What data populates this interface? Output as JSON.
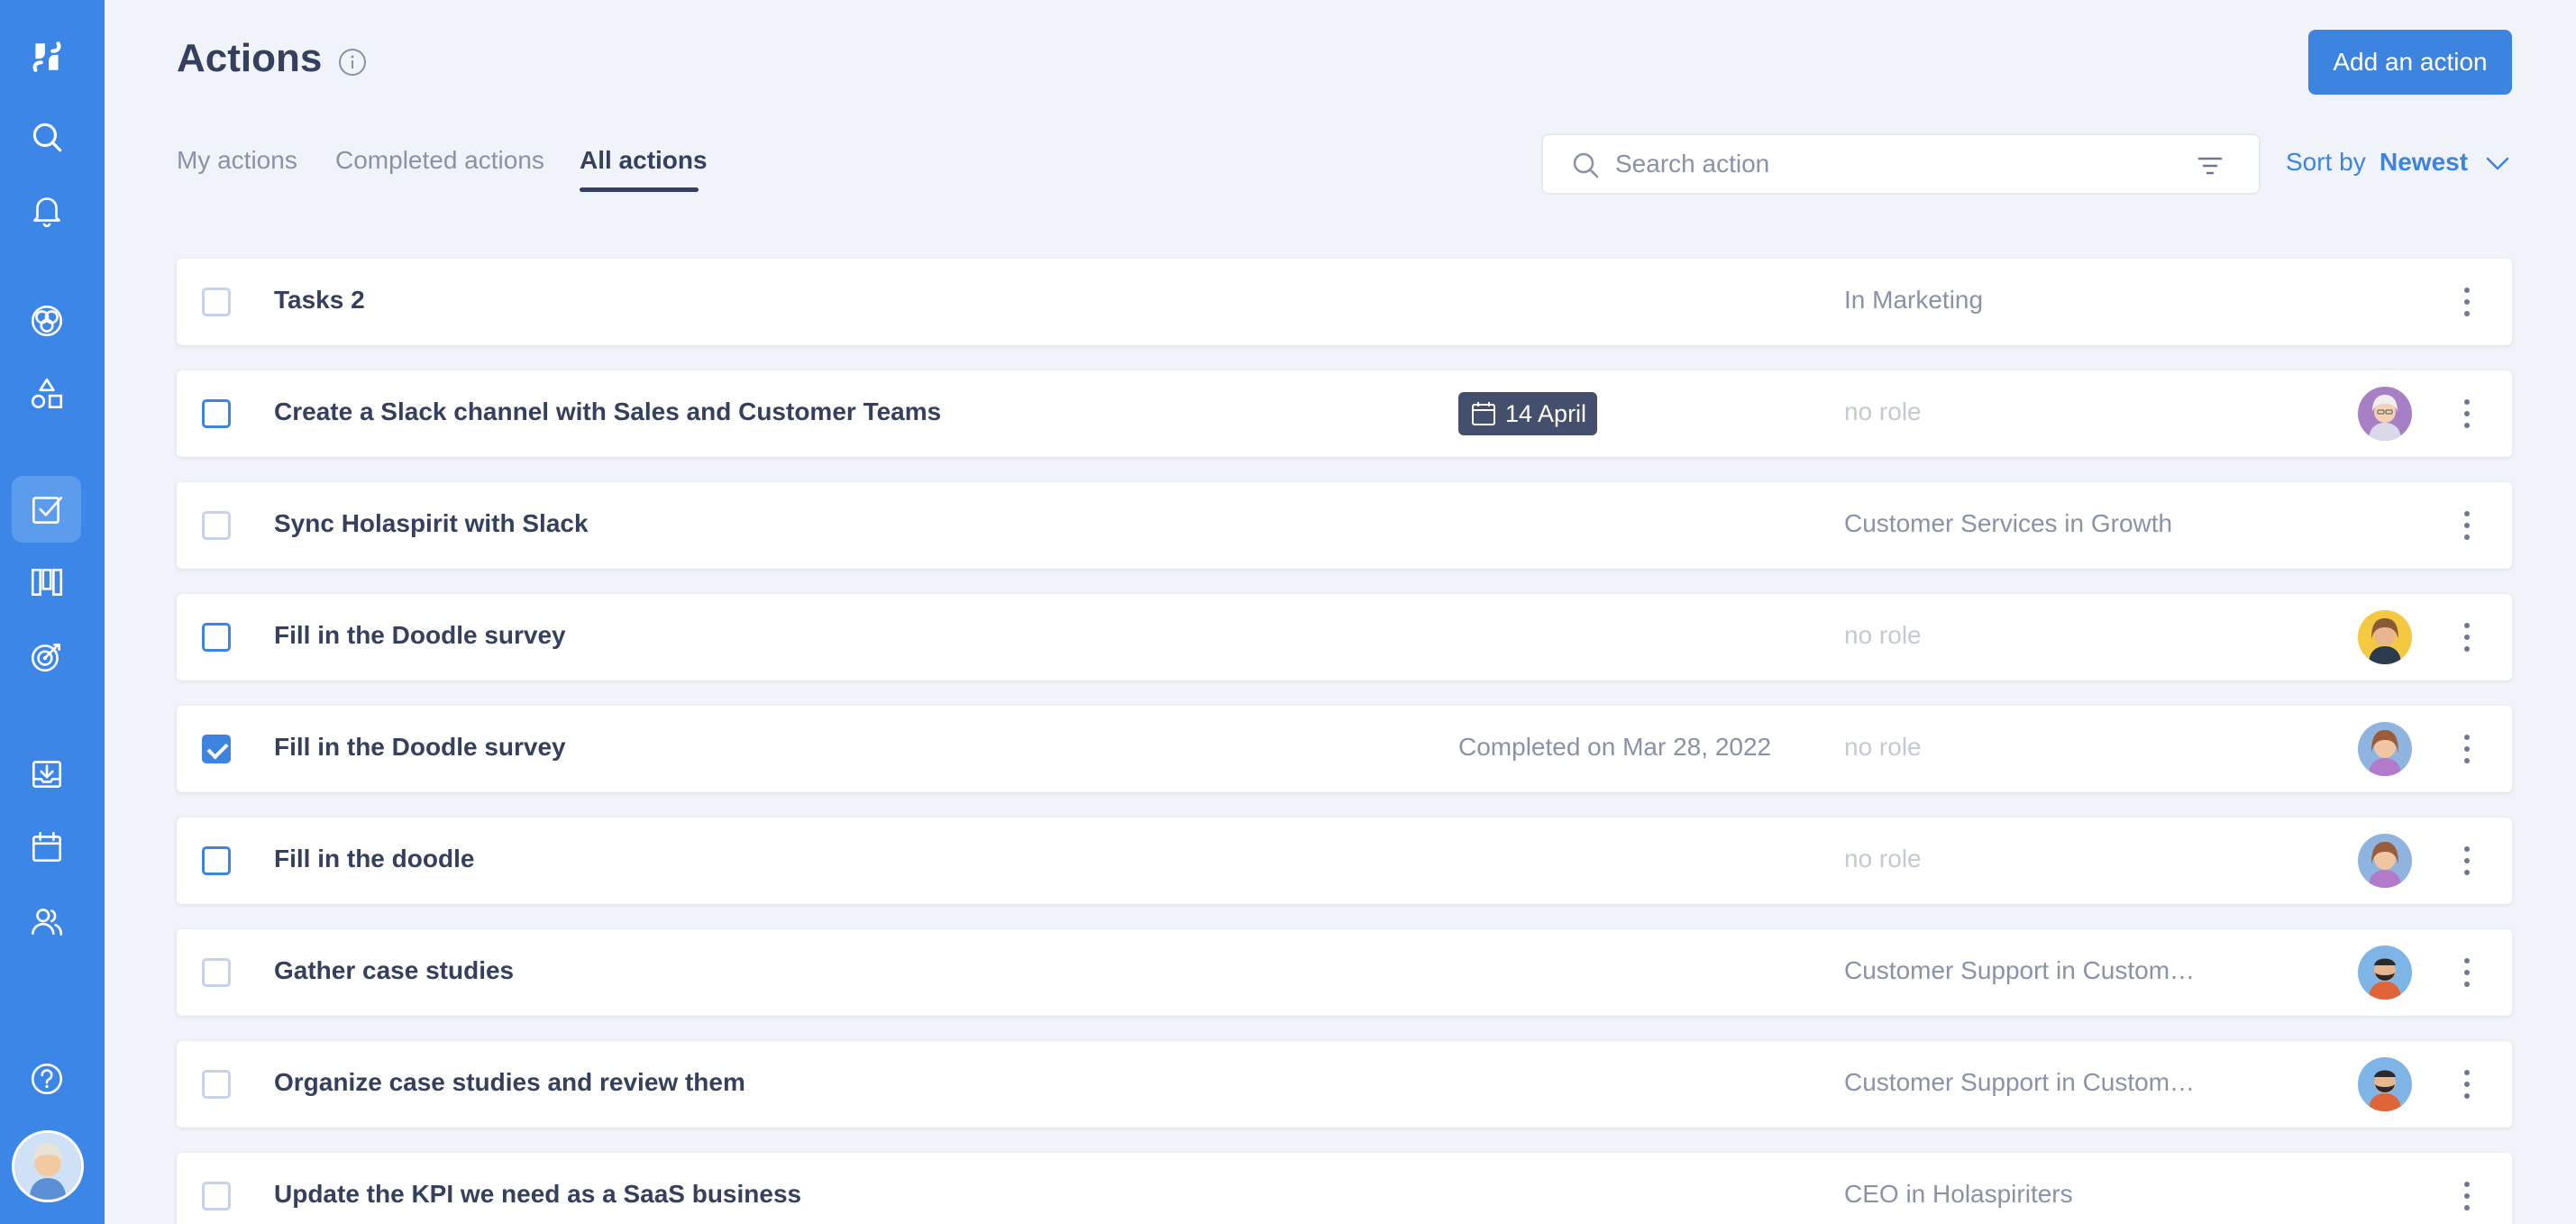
{
  "header": {
    "title": "Actions",
    "add_button": "Add an action"
  },
  "tabs": [
    {
      "label": "My actions",
      "active": false
    },
    {
      "label": "Completed actions",
      "active": false
    },
    {
      "label": "All actions",
      "active": true
    }
  ],
  "search": {
    "placeholder": "Search action",
    "value": ""
  },
  "sort": {
    "label": "Sort by",
    "value": "Newest"
  },
  "colors": {
    "sidebar": "#3b86e6",
    "accent": "#3d83e0",
    "text": "#34405e",
    "muted": "#8a92a8"
  },
  "sidebar": {
    "items": [
      {
        "icon": "holaspirit-logo-icon"
      },
      {
        "icon": "search-icon"
      },
      {
        "icon": "bell-icon"
      },
      {
        "icon": "circles-icon"
      },
      {
        "icon": "roles-shapes-icon"
      },
      {
        "icon": "checkbox-actions-icon",
        "active": true
      },
      {
        "icon": "board-columns-icon"
      },
      {
        "icon": "target-icon"
      },
      {
        "icon": "inbox-download-icon"
      },
      {
        "icon": "calendar-icon"
      },
      {
        "icon": "people-icon"
      },
      {
        "icon": "help-icon"
      },
      {
        "icon": "user-avatar"
      }
    ]
  },
  "actions": [
    {
      "title": "Tasks 2",
      "checked": false,
      "checkbox_style": "light",
      "due": "",
      "completed": "",
      "role": "In Marketing",
      "role_muted": false,
      "avatar": "none"
    },
    {
      "title": "Create a Slack channel with Sales and Customer Teams",
      "checked": false,
      "checkbox_style": "strong",
      "due": "14 April",
      "completed": "",
      "role": "no role",
      "role_muted": true,
      "avatar": "old-woman"
    },
    {
      "title": "Sync Holaspirit with Slack",
      "checked": false,
      "checkbox_style": "light",
      "due": "",
      "completed": "",
      "role": "Customer Services in Growth",
      "role_muted": false,
      "avatar": "none"
    },
    {
      "title": "Fill in the Doodle survey",
      "checked": false,
      "checkbox_style": "strong",
      "due": "",
      "completed": "",
      "role": "no role",
      "role_muted": true,
      "avatar": "woman-yellow"
    },
    {
      "title": "Fill in the Doodle survey",
      "checked": true,
      "checkbox_style": "strong",
      "due": "",
      "completed": "Completed on Mar 28, 2022",
      "role": "no role",
      "role_muted": true,
      "avatar": "woman-blue"
    },
    {
      "title": "Fill in the doodle",
      "checked": false,
      "checkbox_style": "strong",
      "due": "",
      "completed": "",
      "role": "no role",
      "role_muted": true,
      "avatar": "woman-blue"
    },
    {
      "title": "Gather case studies",
      "checked": false,
      "checkbox_style": "light",
      "due": "",
      "completed": "",
      "role": "Customer Support in Custom…",
      "role_muted": false,
      "avatar": "bearded-man"
    },
    {
      "title": "Organize case studies and review them",
      "checked": false,
      "checkbox_style": "light",
      "due": "",
      "completed": "",
      "role": "Customer Support in Custom…",
      "role_muted": false,
      "avatar": "bearded-man"
    },
    {
      "title": "Update the KPI we need as a SaaS business",
      "checked": false,
      "checkbox_style": "light",
      "due": "",
      "completed": "",
      "role": "CEO in Holaspiriters",
      "role_muted": false,
      "avatar": "none"
    }
  ]
}
